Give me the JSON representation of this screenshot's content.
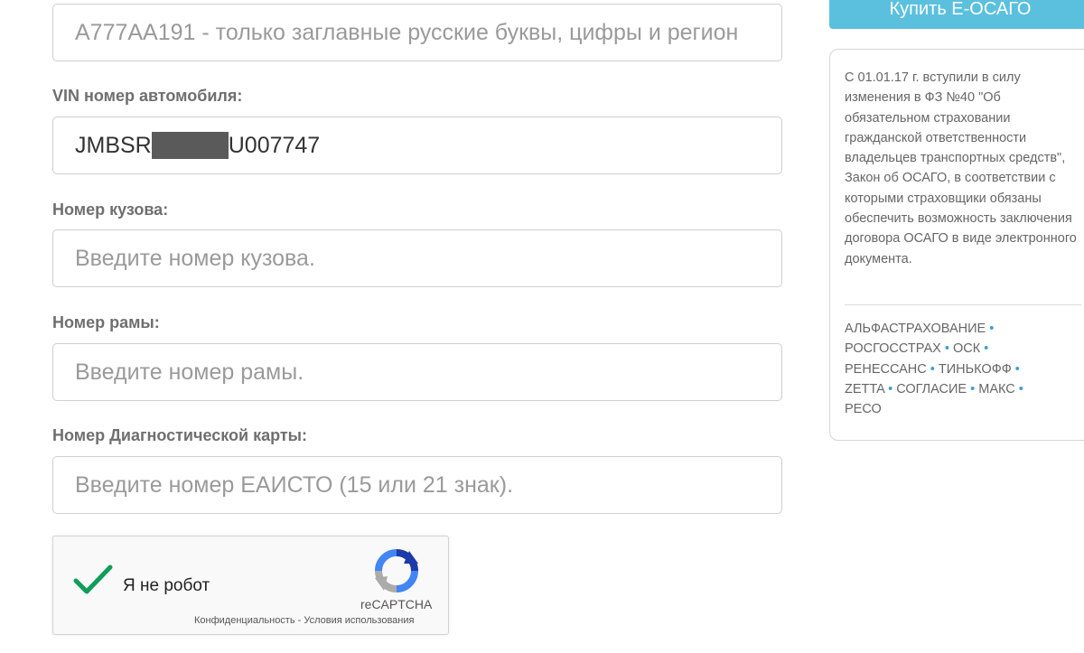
{
  "form": {
    "plate_placeholder": "А777АА191 - только заглавные русские буквы, цифры и регион",
    "vin_label": "VIN номер автомобиля:",
    "vin_prefix": "JMBSR",
    "vin_suffix": "U007747",
    "body_label": "Номер кузова:",
    "body_placeholder": "Введите номер кузова.",
    "frame_label": "Номер рамы:",
    "frame_placeholder": "Введите номер рамы.",
    "diag_label": "Номер Диагностической карты:",
    "diag_placeholder": "Введите номер ЕАИСТО (15 или 21 знак)."
  },
  "captcha": {
    "label": "Я не робот",
    "checked": true,
    "brand": "reCAPTCHA",
    "privacy": "Конфиденциальность",
    "separator": " - ",
    "terms": "Условия использования"
  },
  "sidebar": {
    "buy_button": "Купить Е-ОСАГО",
    "info_text": "С 01.01.17 г. вступили в силу изменения в ФЗ №40 \"Об обязательном страховании гражданской ответственности владельцев транспортных средств\", Закон об ОСАГО, в соответствии с которыми страховщики обязаны обеспечить возможность заключения договора ОСАГО в виде электронного документа.",
    "insurers": [
      "АЛЬФАСТРАХОВАНИЕ",
      "РОСГОССТРАХ",
      "ОСК",
      "РЕНЕССАНС",
      "ТИНЬКОФФ",
      "ZETTA",
      "СОГЛАСИЕ",
      "МАКС",
      "РЕСО"
    ],
    "bullet": "•"
  },
  "colors": {
    "accent": "#5bc0de",
    "bullet": "#3aa0d0",
    "check": "#0f9d58"
  }
}
